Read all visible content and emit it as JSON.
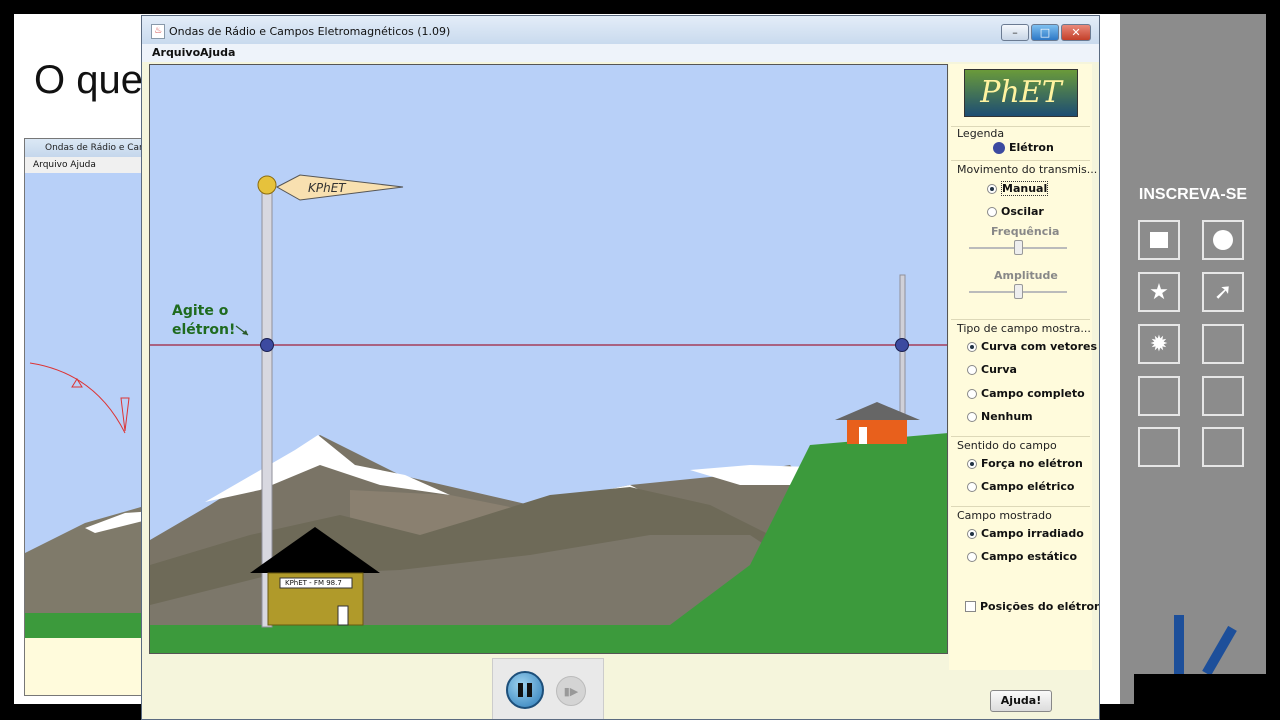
{
  "slide": {
    "title": "O que"
  },
  "background_window": {
    "title": "Ondas de Rádio e Campos",
    "menu": "Arquivo  Ajuda"
  },
  "side_panel": {
    "subscribe": "INSCREVA-SE",
    "icons": [
      "square-icon",
      "circle-icon",
      "star-icon",
      "arrow-icon",
      "burst-icon",
      "empty",
      "empty",
      "empty",
      "empty",
      "empty"
    ]
  },
  "window": {
    "title": "Ondas de Rádio e Campos Eletromagnéticos (1.09)",
    "menu": {
      "file": "Arquivo",
      "help": "Ajuda"
    },
    "buttons": {
      "minimize": "–",
      "maximize": "□",
      "close": "✕"
    }
  },
  "scene": {
    "flag_label": "KPhET",
    "prompt": [
      "Agite o",
      "elétron!"
    ],
    "station_sign": "KPhET - FM 98.7"
  },
  "controls": {
    "logo": "PhET",
    "legend": {
      "title": "Legenda",
      "item": "Elétron"
    },
    "movement": {
      "title": "Movimento do transmis...",
      "options": [
        "Manual",
        "Oscilar"
      ],
      "selected": 0,
      "frequency_label": "Frequência",
      "amplitude_label": "Amplitude",
      "frequency_level": 0.5,
      "amplitude_level": 0.5
    },
    "field_type": {
      "title": "Tipo de campo mostra...",
      "options": [
        "Curva com vetores",
        "Curva",
        "Campo completo",
        "Nenhum"
      ],
      "selected": 0
    },
    "field_sense": {
      "title": "Sentido do campo",
      "options": [
        "Força no elétron",
        "Campo elétrico"
      ],
      "selected": 0
    },
    "field_shown": {
      "title": "Campo mostrado",
      "options": [
        "Campo irradiado",
        "Campo estático"
      ],
      "selected": 0
    },
    "positions_checkbox": {
      "label": "Posições do elétron",
      "checked": false
    },
    "help_button": "Ajuda!"
  },
  "playback": {
    "pause": "pause-icon",
    "step": "step-icon"
  },
  "colors": {
    "sky": "#b8d0f8",
    "grass": "#3c9a3c",
    "panel": "#fffbdc",
    "field_line": "#a0203c"
  }
}
